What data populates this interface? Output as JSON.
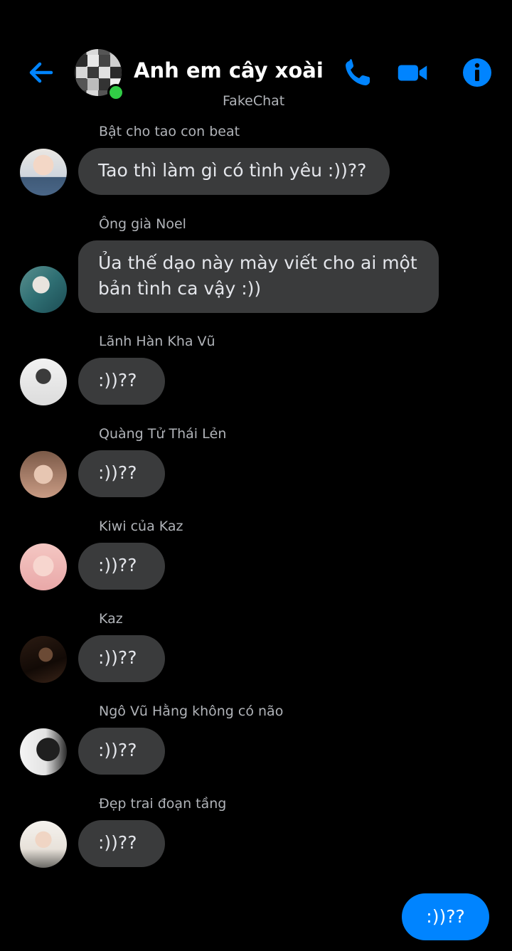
{
  "header": {
    "title": "Anh em cây xoài",
    "subtitle": "FakeChat",
    "accent_color": "#0084ff",
    "online_color": "#31cc46",
    "icons": {
      "back": "back-arrow-icon",
      "call": "phone-icon",
      "video": "video-camera-icon",
      "info": "info-icon"
    }
  },
  "messages": [
    {
      "sender": "Bật cho tao con beat",
      "text": "Tao thì làm gì có tình yêu :))??"
    },
    {
      "sender": "Ông già Noel",
      "text_line1": "Ủa thế dạo này mày viết cho ai một",
      "text_line2": "bản tình ca vậy :))"
    },
    {
      "sender": "Lãnh Hàn Kha Vũ",
      "text": ":))??"
    },
    {
      "sender": "Quàng Tử Thái Lẻn",
      "text": ":))??"
    },
    {
      "sender": "Kiwi của Kaz",
      "text": ":))??"
    },
    {
      "sender": "Kaz",
      "text": ":))??"
    },
    {
      "sender": "Ngô Vũ Hằng không có não",
      "text": ":))??"
    },
    {
      "sender": "Đẹp trai đoạn tầng",
      "text": ":))??"
    }
  ],
  "outgoing_message": {
    "text": ":))??"
  }
}
